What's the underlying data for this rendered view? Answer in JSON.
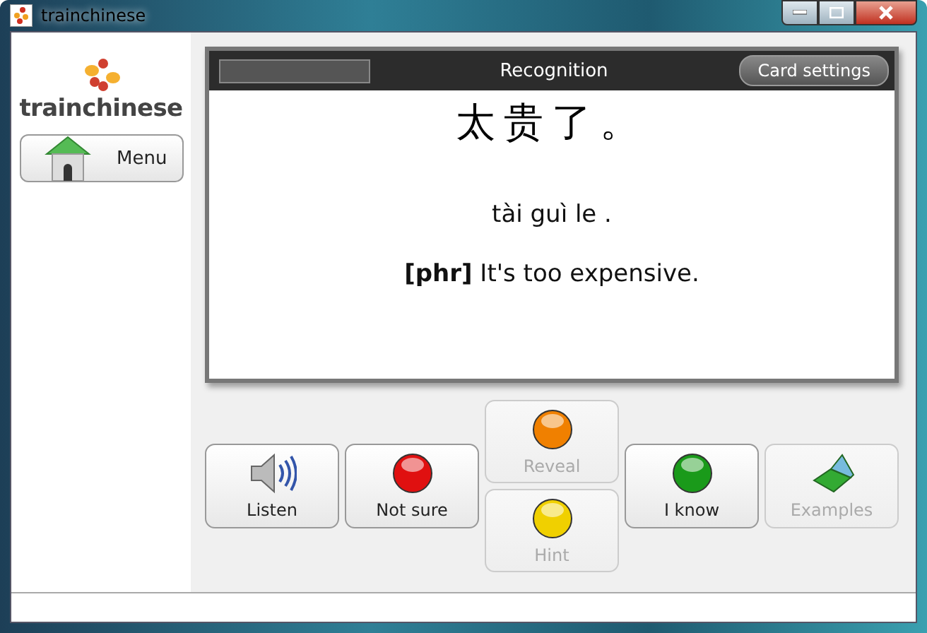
{
  "window": {
    "title": "trainchinese"
  },
  "sidebar": {
    "logo_text": "trainchinese",
    "menu_button": "Menu"
  },
  "card": {
    "progress": {
      "level": 0
    },
    "title": "Recognition",
    "settings_button": "Card settings",
    "hanzi": "太贵了。",
    "pinyin": "tài guì le .",
    "definition": "**[phr]** It's too expensive."
  },
  "buttons": [
    {
      "kind": "speaker",
      "label": "Listen",
      "disabled": false
    },
    {
      "kind": "ball",
      "label": "Not sure",
      "color": "#e01010",
      "disabled": false
    },
    {
      "kind": "stack",
      "items": [
        {
          "kind": "ball",
          "label": "Reveal",
          "color": "#f08000",
          "disabled": true
        },
        {
          "kind": "ball",
          "label": "Hint",
          "color": "#f0d000",
          "disabled": true
        }
      ]
    },
    {
      "kind": "ball",
      "label": "I know",
      "color": "#1a9a1a",
      "disabled": false
    },
    {
      "kind": "laptop",
      "label": "Examples",
      "disabled": true
    }
  ]
}
